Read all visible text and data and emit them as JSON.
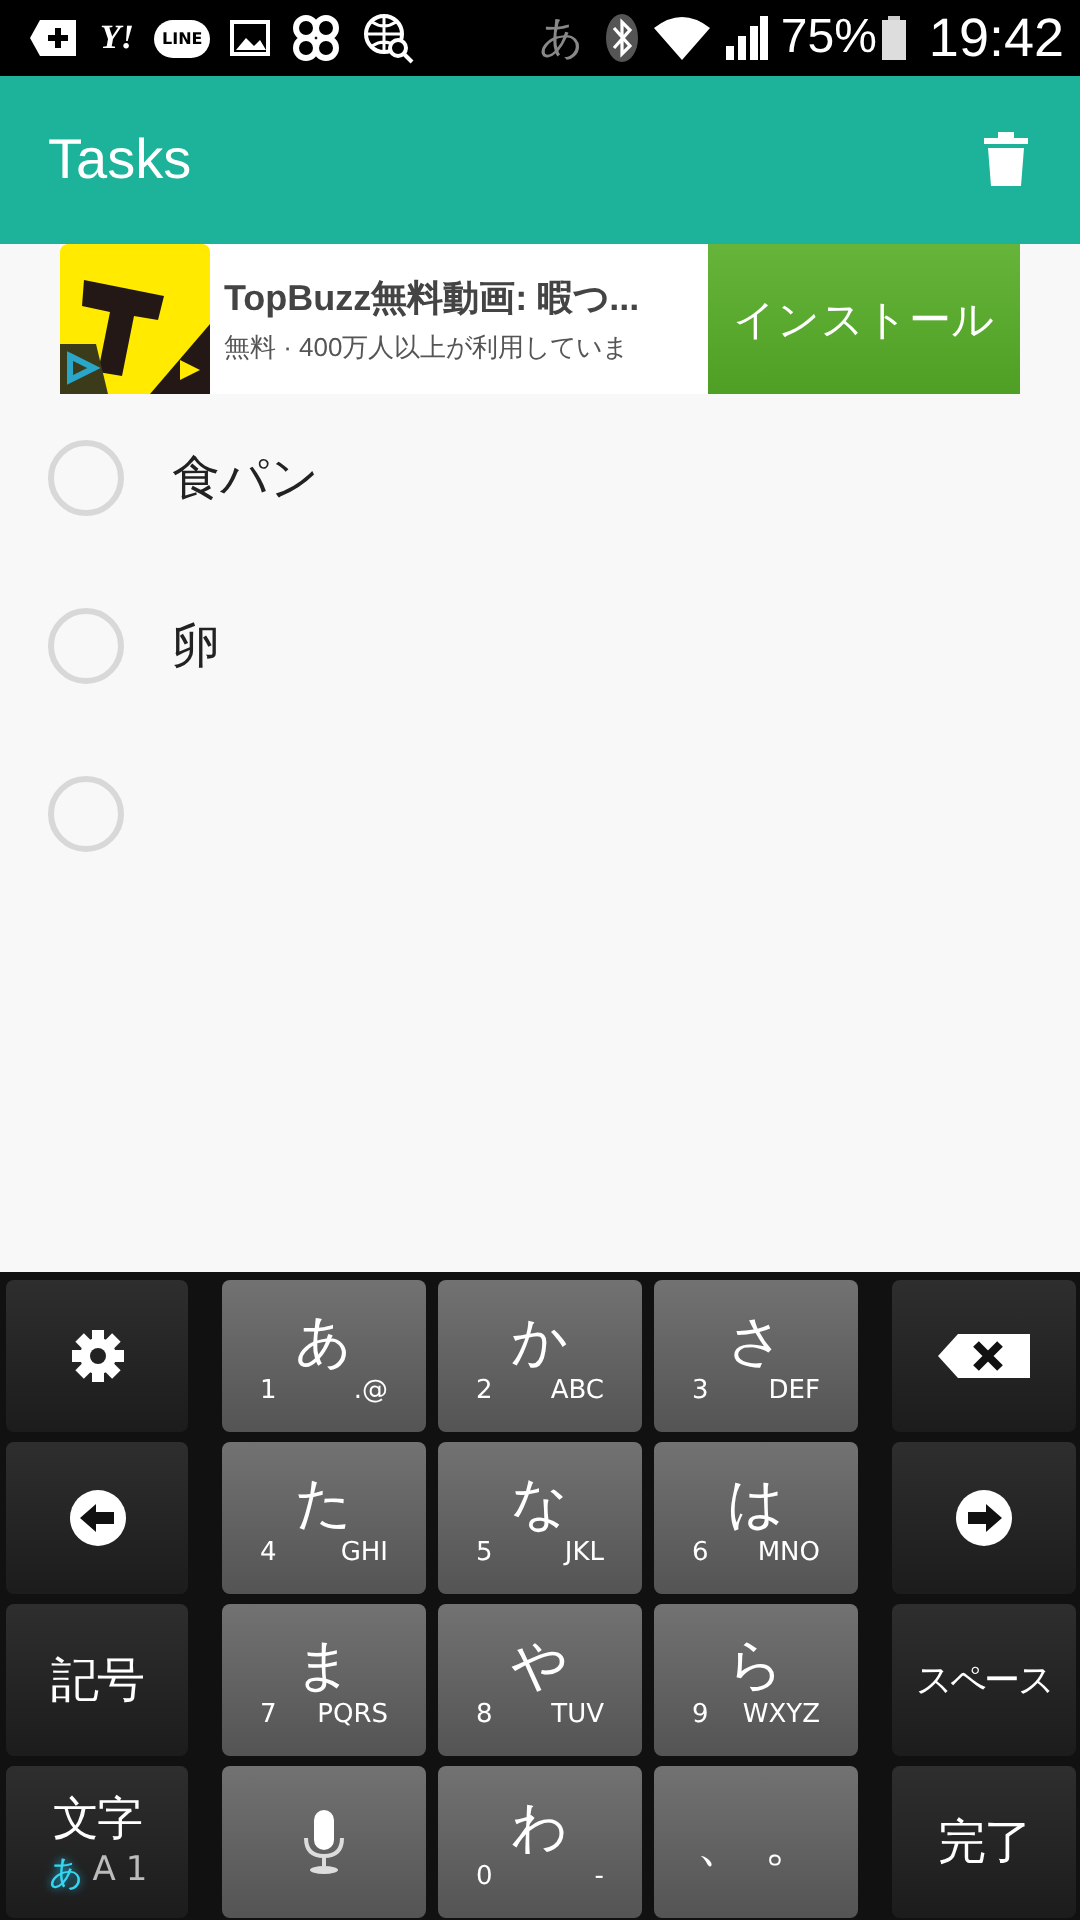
{
  "status_bar": {
    "yahoo_label": "Y!",
    "line_label": "LINE",
    "input_mode": "あ",
    "battery": "75%",
    "time": "19:42"
  },
  "app_bar": {
    "title": "Tasks"
  },
  "ad": {
    "title": "TopBuzz無料動画: 暇つ...",
    "subtitle": "無料 · 400万人以上が利用していま",
    "button": "インストール"
  },
  "tasks": [
    {
      "text": "食パン",
      "checked": false
    },
    {
      "text": "卵",
      "checked": false
    },
    {
      "checked": false
    }
  ],
  "keyboard": {
    "rows": [
      [
        {
          "kind": "settings"
        },
        {
          "kind": "kana",
          "main": "あ",
          "num": "1",
          "letters": ".@"
        },
        {
          "kind": "kana",
          "main": "か",
          "num": "2",
          "letters": "ABC"
        },
        {
          "kind": "kana",
          "main": "さ",
          "num": "3",
          "letters": "DEF"
        },
        {
          "kind": "backspace"
        }
      ],
      [
        {
          "kind": "left"
        },
        {
          "kind": "kana",
          "main": "た",
          "num": "4",
          "letters": "GHI"
        },
        {
          "kind": "kana",
          "main": "な",
          "num": "5",
          "letters": "JKL"
        },
        {
          "kind": "kana",
          "main": "は",
          "num": "6",
          "letters": "MNO"
        },
        {
          "kind": "right"
        }
      ],
      [
        {
          "kind": "label",
          "label": "記号"
        },
        {
          "kind": "kana",
          "main": "ま",
          "num": "7",
          "letters": "PQRS"
        },
        {
          "kind": "kana",
          "main": "や",
          "num": "8",
          "letters": "TUV"
        },
        {
          "kind": "kana",
          "main": "ら",
          "num": "9",
          "letters": "WXYZ"
        },
        {
          "kind": "label",
          "label": "スペース"
        }
      ],
      [
        {
          "kind": "mode",
          "label": "文字",
          "modes": [
            {
              "label": "あ",
              "selected": true
            },
            {
              "label": "A",
              "selected": false
            },
            {
              "label": "1",
              "selected": false
            }
          ]
        },
        {
          "kind": "mic"
        },
        {
          "kind": "kana",
          "main": "わ",
          "num": "0",
          "letters": "-"
        },
        {
          "kind": "punct",
          "label": "、 。"
        },
        {
          "kind": "label",
          "label": "完了"
        }
      ]
    ]
  }
}
